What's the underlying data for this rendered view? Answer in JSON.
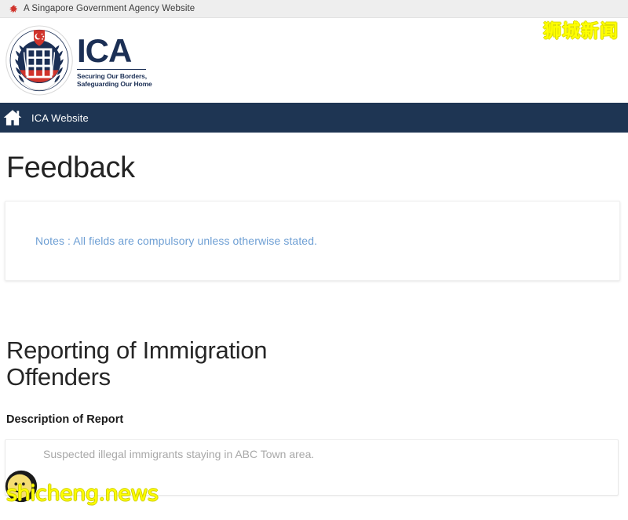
{
  "gov_banner": {
    "icon": "singapore-lion-icon",
    "text": "A Singapore Government Agency Website"
  },
  "branding": {
    "crest_icon": "ica-crest-icon",
    "wordmark": "ICA",
    "tagline_line1": "Securing Our Borders,",
    "tagline_line2": "Safeguarding Our Home"
  },
  "navbar": {
    "home_icon": "home-icon",
    "link_label": "ICA Website",
    "background_color": "#1e3553"
  },
  "page": {
    "title": "Feedback"
  },
  "notes": {
    "text": "Notes : All fields are compulsory unless otherwise stated.",
    "color": "#6e9fd4"
  },
  "form": {
    "section_title": "Reporting of Immigration Offenders",
    "description_label": "Description of Report",
    "description_value": "",
    "description_placeholder": "Suspected illegal immigrants staying in ABC Town area."
  },
  "watermarks": {
    "chinese_text": "狮城新闻",
    "brand_text": "shicheng.news",
    "smiley_icon": "smiley-face-icon",
    "color": "#ffff00"
  }
}
